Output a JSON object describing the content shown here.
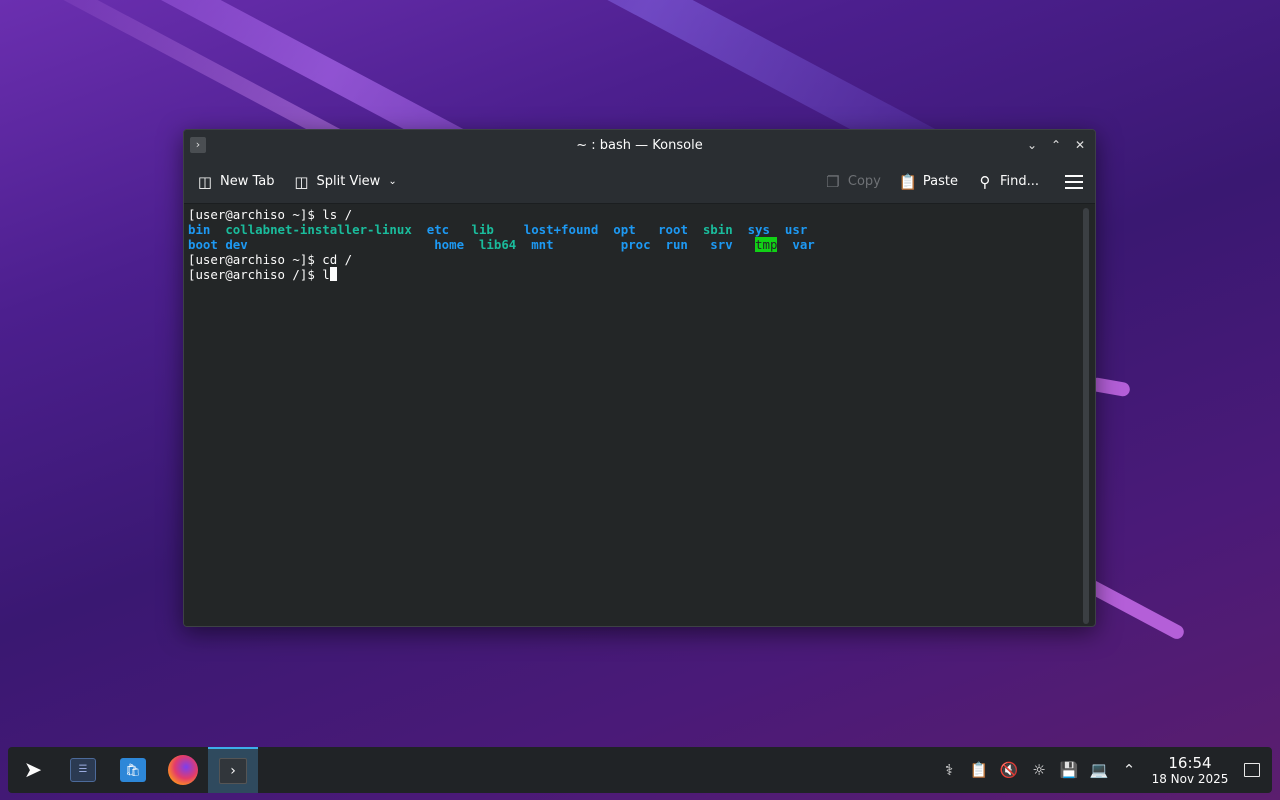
{
  "window": {
    "title": "~ : bash — Konsole",
    "app_icon": "›"
  },
  "toolbar": {
    "new_tab": "New Tab",
    "split_view": "Split View",
    "copy": "Copy",
    "paste": "Paste",
    "find": "Find..."
  },
  "terminal": {
    "prompt_home": "[user@archiso ~]$ ",
    "prompt_root": "[user@archiso /]$ ",
    "cmd1": "ls /",
    "cmd2": "cd /",
    "cmd3": "l",
    "row1": [
      "bin",
      "collabnet-installer-linux",
      "etc",
      "lib",
      "lost+found",
      "opt",
      "root",
      "sbin",
      "sys",
      "usr"
    ],
    "row2": [
      "boot",
      "dev",
      "home",
      "lib64",
      "mnt",
      "proc",
      "run",
      "srv",
      "tmp",
      "var"
    ]
  },
  "clock": {
    "time": "16:54",
    "date": "18 Nov 2025"
  },
  "colors": {
    "directory": "#1d99f3",
    "symlink": "#1abc9c",
    "sticky_bg": "#11d116",
    "terminal_bg": "#232627"
  }
}
